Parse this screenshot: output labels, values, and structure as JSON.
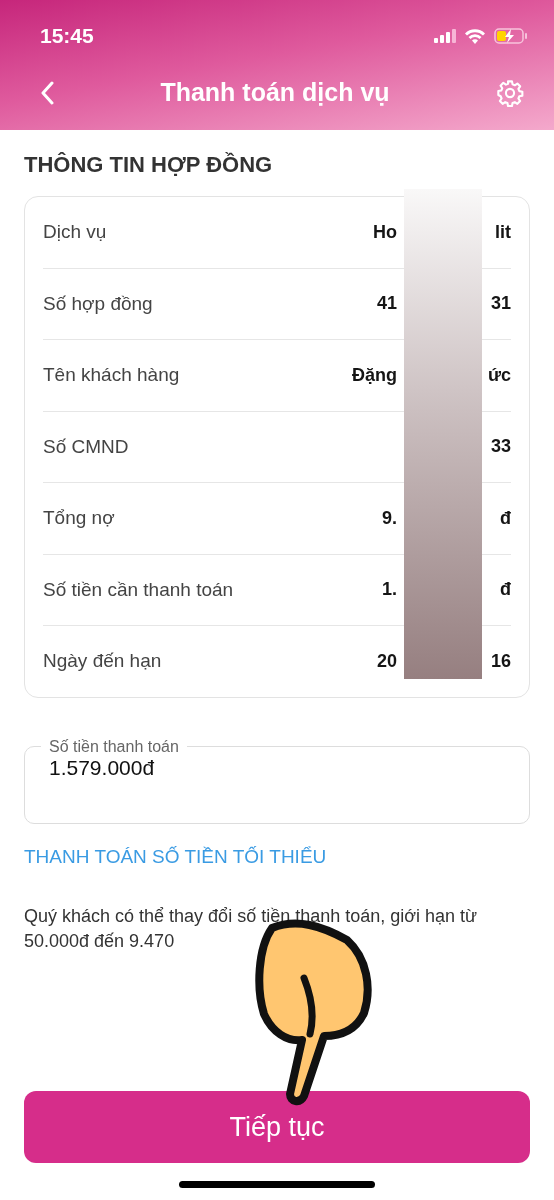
{
  "status_bar": {
    "time": "15:45",
    "charging": true
  },
  "header": {
    "title": "Thanh toán dịch vụ"
  },
  "section_title": "THÔNG TIN HỢP ĐỒNG",
  "contract_rows": [
    {
      "label": "Dịch vụ",
      "value_head": "Ho",
      "value_tail": "lit"
    },
    {
      "label": "Số hợp đồng",
      "value_head": "41",
      "value_tail": "31"
    },
    {
      "label": "Tên khách hàng",
      "value_head": "Đặng",
      "value_tail": "ức"
    },
    {
      "label": "Số CMND",
      "value_tail": "33"
    },
    {
      "label": "Tổng nợ",
      "value_head": "9.",
      "value_tail": "đ"
    },
    {
      "label": "Số tiền cần thanh toán",
      "value_head": "1.",
      "value_tail": "đ"
    },
    {
      "label": "Ngày đến hạn",
      "value_head": "20",
      "value_tail": "16"
    }
  ],
  "amount_field": {
    "label": "Số tiền thanh toán",
    "value": "1.579.000đ"
  },
  "minimum_link": "THANH TOÁN SỐ TIỀN TỐI THIỂU",
  "note": "Quý khách có thể thay đổi số tiền thanh toán, giới hạn từ 50.000đ đến 9.470",
  "continue_button": "Tiếp tục"
}
